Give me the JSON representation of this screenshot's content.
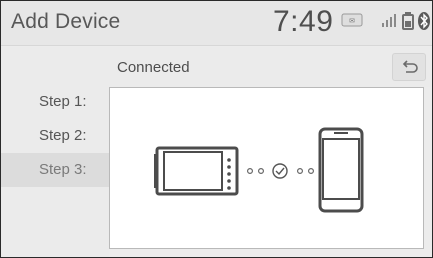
{
  "header": {
    "title": "Add Device",
    "clock": "7:49",
    "status_icons": [
      "mail-icon",
      "signal-icon",
      "battery-icon",
      "bluetooth-icon"
    ]
  },
  "subheader": {
    "status": "Connected",
    "back_icon": "return-arrow-icon"
  },
  "steps": [
    {
      "label": "Step 1:"
    },
    {
      "label": "Step 2:"
    },
    {
      "label": "Step 3:"
    }
  ],
  "illustration": {
    "left_device": "head-unit-screen-icon",
    "middle": "check-circle-icon",
    "right_device": "smartphone-icon"
  },
  "colors": {
    "background": "#ececec",
    "text": "#555555",
    "panel": "#ffffff"
  }
}
